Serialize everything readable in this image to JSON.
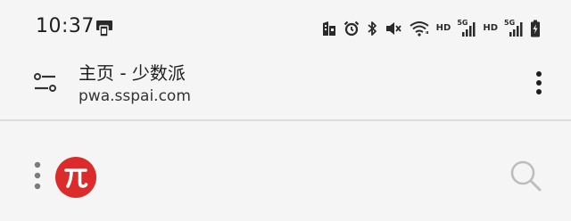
{
  "status_bar": {
    "time": "10:37",
    "left_icons": [
      "screen-cast-icon"
    ],
    "right_icons": [
      "sim-manager-icon",
      "alarm-icon",
      "bluetooth-icon",
      "mute-icon",
      "wifi-icon",
      "signal-1-icon",
      "signal-2-icon",
      "battery-charging-icon"
    ],
    "hd_1": "HD",
    "hd_2": "HD",
    "net_1": "5G",
    "net_2": "5G"
  },
  "browser": {
    "title": "主页 - 少数派",
    "url": "pwa.sspai.com",
    "left_icon": "tune-icon",
    "menu_icon": "more-vert-icon"
  },
  "site": {
    "menu_icon": "more-vert-icon",
    "logo_glyph": "π",
    "logo_color": "#dc2b2b",
    "search_icon": "search-icon"
  }
}
